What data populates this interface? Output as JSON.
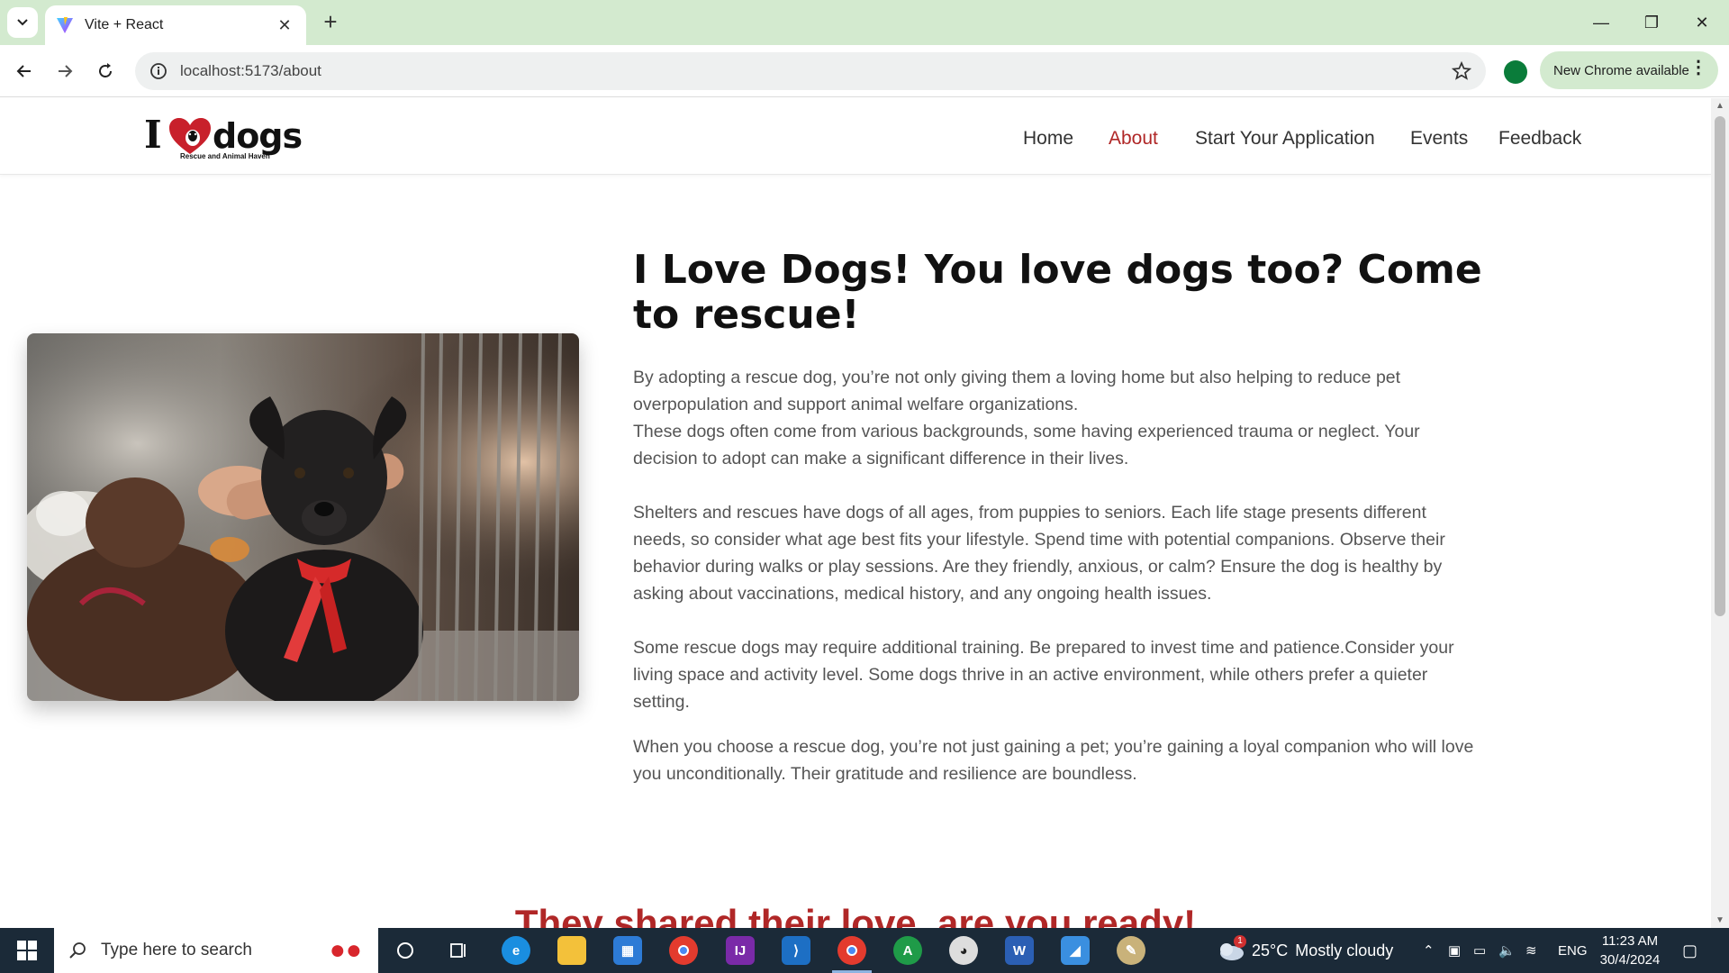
{
  "browser": {
    "tab_title": "Vite + React",
    "url": "localhost:5173/about",
    "update_button": "New Chrome available"
  },
  "site": {
    "logo_text_i": "I",
    "logo_text_dogs": "dogs",
    "logo_tagline": "Rescue and Animal Haven",
    "nav": [
      {
        "label": "Home"
      },
      {
        "label": "About"
      },
      {
        "label": "Start Your Application"
      },
      {
        "label": "Events"
      },
      {
        "label": "Feedback"
      }
    ],
    "active_nav": "About"
  },
  "about": {
    "headline": "I Love Dogs! You love dogs too? Come to rescue!",
    "para1": "By adopting a rescue dog, you’re not only giving them a loving home but also helping to reduce pet overpopulation and support animal welfare organizations.",
    "para2": "These dogs often come from various backgrounds, some having experienced trauma or neglect. Your decision to adopt can make a significant difference in their lives.",
    "para3": "Shelters and rescues have dogs of all ages, from puppies to seniors. Each life stage presents different needs, so consider what age best fits your lifestyle. Spend time with potential companions. Observe their behavior during walks or play sessions. Are they friendly, anxious, or calm? Ensure the dog is healthy by asking about vaccinations, medical history, and any ongoing health issues.",
    "para4": "Some rescue dogs may require additional training. Be prepared to invest time and patience.Consider your living space and activity level. Some dogs thrive in an active environment, while others prefer a quieter setting.",
    "para5": "When you choose a rescue dog, you’re not just gaining a pet; you’re gaining a loyal companion who will love you unconditionally. Their gratitude and resilience are boundless.",
    "next_section_title": "They shared their love, are you ready!"
  },
  "taskbar": {
    "search_placeholder": "Type here to search",
    "weather_temp": "25°C",
    "weather_desc": "Mostly cloudy",
    "weather_badge": "1",
    "language": "ENG",
    "time": "11:23 AM",
    "date": "30/4/2024",
    "apps": [
      "cortana",
      "task-view",
      "edge",
      "file-explorer",
      "microsoft-store",
      "chrome",
      "intellij",
      "vscode",
      "chrome-active",
      "chrome-profile",
      "app-penguin",
      "word",
      "app-blue",
      "paint"
    ]
  },
  "colors": {
    "accent_red": "#b02727",
    "tabstrip_green": "#d3eacf",
    "taskbar": "#1b2a38"
  }
}
